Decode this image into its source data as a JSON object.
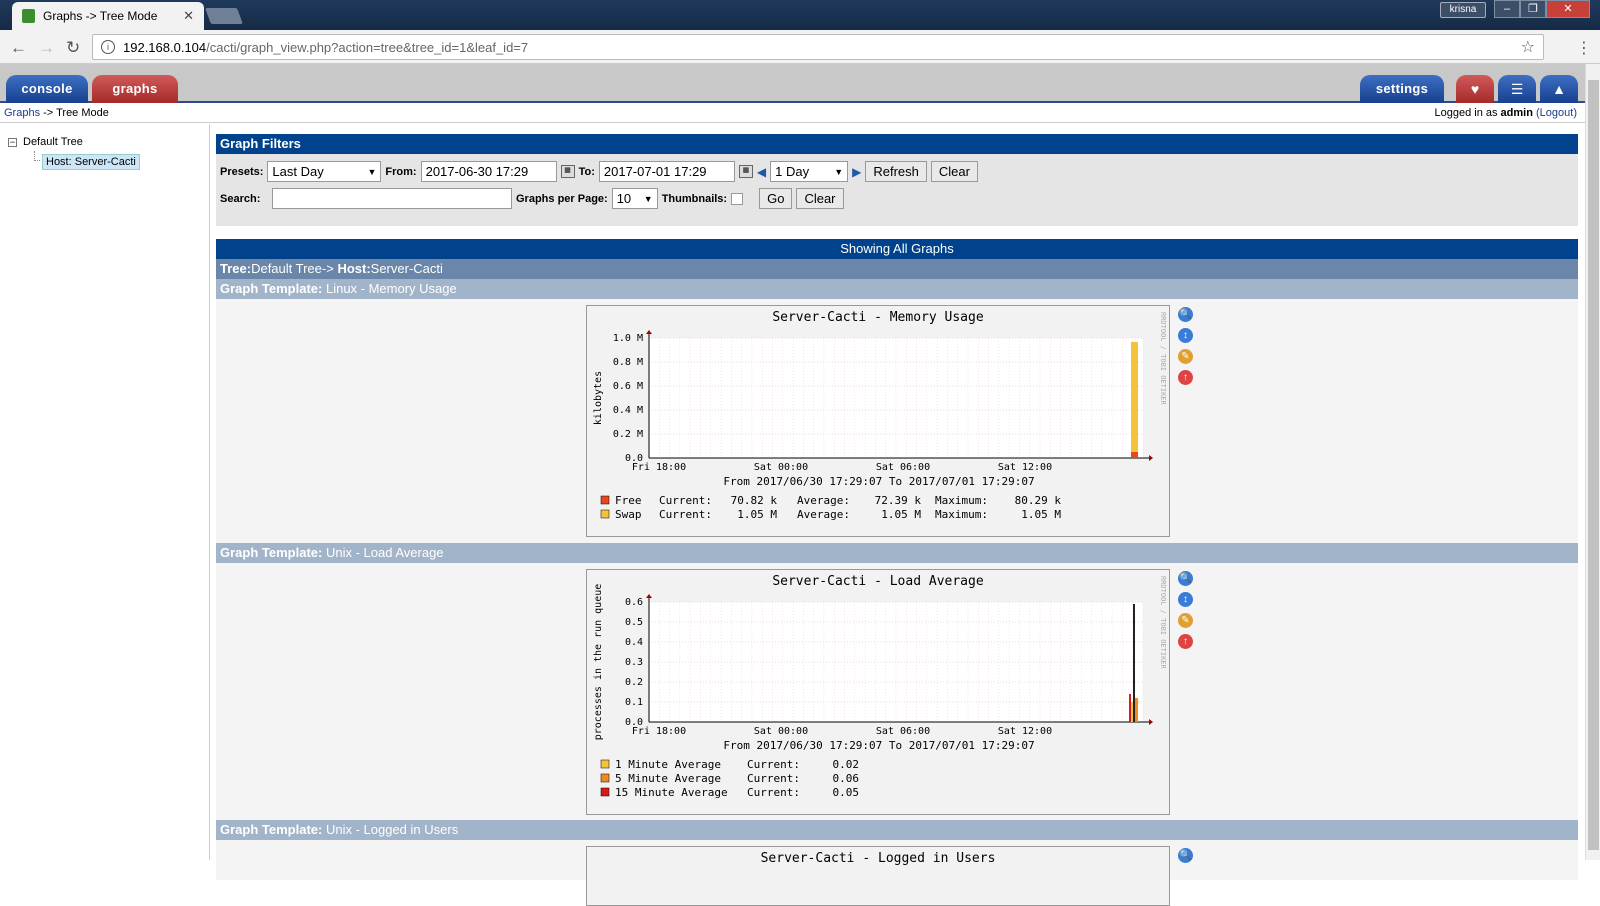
{
  "browser": {
    "tab_title": "Graphs -> Tree Mode",
    "url_host": "192.168.0.104",
    "url_path": "/cacti/graph_view.php?action=tree&tree_id=1&leaf_id=7",
    "profile": "krisna"
  },
  "cacti": {
    "tabs": {
      "console": "console",
      "graphs": "graphs",
      "settings": "settings"
    },
    "breadcrumb": {
      "root": "Graphs",
      "sep": " -> ",
      "current": "Tree Mode"
    },
    "login": {
      "prefix": "Logged in as ",
      "user": "admin",
      "logout": "(Logout)"
    }
  },
  "tree": {
    "root": "Default Tree",
    "leaf": "Host: Server-Cacti"
  },
  "filters": {
    "header": "Graph Filters",
    "presets_label": "Presets:",
    "presets_value": "Last Day",
    "from_label": "From:",
    "from_value": "2017-06-30 17:29",
    "to_label": "To:",
    "to_value": "2017-07-01 17:29",
    "span_value": "1 Day",
    "refresh": "Refresh",
    "clear": "Clear",
    "search_label": "Search:",
    "search_value": "",
    "gpp_label": "Graphs per Page:",
    "gpp_value": "10",
    "thumbs_label": "Thumbnails:",
    "go": "Go",
    "clear2": "Clear"
  },
  "content": {
    "showing": "Showing All Graphs",
    "tree_path": {
      "tree_label": "Tree:",
      "tree": "Default Tree-> ",
      "host_label": "Host:",
      "host": "Server-Cacti"
    },
    "template_label": "Graph Template:",
    "templates": [
      "Linux - Memory Usage",
      "Unix - Load Average",
      "Unix - Logged in Users"
    ]
  },
  "graphs": [
    {
      "title": "Server-Cacti - Memory Usage",
      "ylabel": "kilobytes",
      "yticks": [
        "1.0 M",
        "0.8 M",
        "0.6 M",
        "0.4 M",
        "0.2 M",
        "0.0"
      ],
      "xticks": [
        "Fri 18:00",
        "Sat 00:00",
        "Sat 06:00",
        "Sat 12:00"
      ],
      "range": "From 2017/06/30 17:29:07 To 2017/07/01 17:29:07",
      "legend": [
        {
          "name": "Free",
          "color": "#e8471f",
          "current": "70.82 k",
          "average": "72.39 k",
          "maximum": "80.29 k"
        },
        {
          "name": "Swap",
          "color": "#f5c33b",
          "current": "1.05 M",
          "average": "1.05 M",
          "maximum": "1.05 M"
        }
      ]
    },
    {
      "title": "Server-Cacti - Load Average",
      "ylabel": "processes in the run queue",
      "yticks": [
        "0.6",
        "0.5",
        "0.4",
        "0.3",
        "0.2",
        "0.1",
        "0.0"
      ],
      "xticks": [
        "Fri 18:00",
        "Sat 00:00",
        "Sat 06:00",
        "Sat 12:00"
      ],
      "range": "From 2017/06/30 17:29:07 To 2017/07/01 17:29:07",
      "legend": [
        {
          "name": "1 Minute Average",
          "color": "#f5c33b",
          "current": "0.02"
        },
        {
          "name": "5 Minute Average",
          "color": "#f08c1f",
          "current": "0.06"
        },
        {
          "name": "15 Minute Average",
          "color": "#d91a1a",
          "current": "0.05"
        }
      ]
    },
    {
      "title": "Server-Cacti - Logged in Users"
    }
  ],
  "legend_labels": {
    "current": "Current:",
    "average": "Average:",
    "maximum": "Maximum:"
  },
  "rrd_label": "RRDTOOL / TOBI OETIKER"
}
